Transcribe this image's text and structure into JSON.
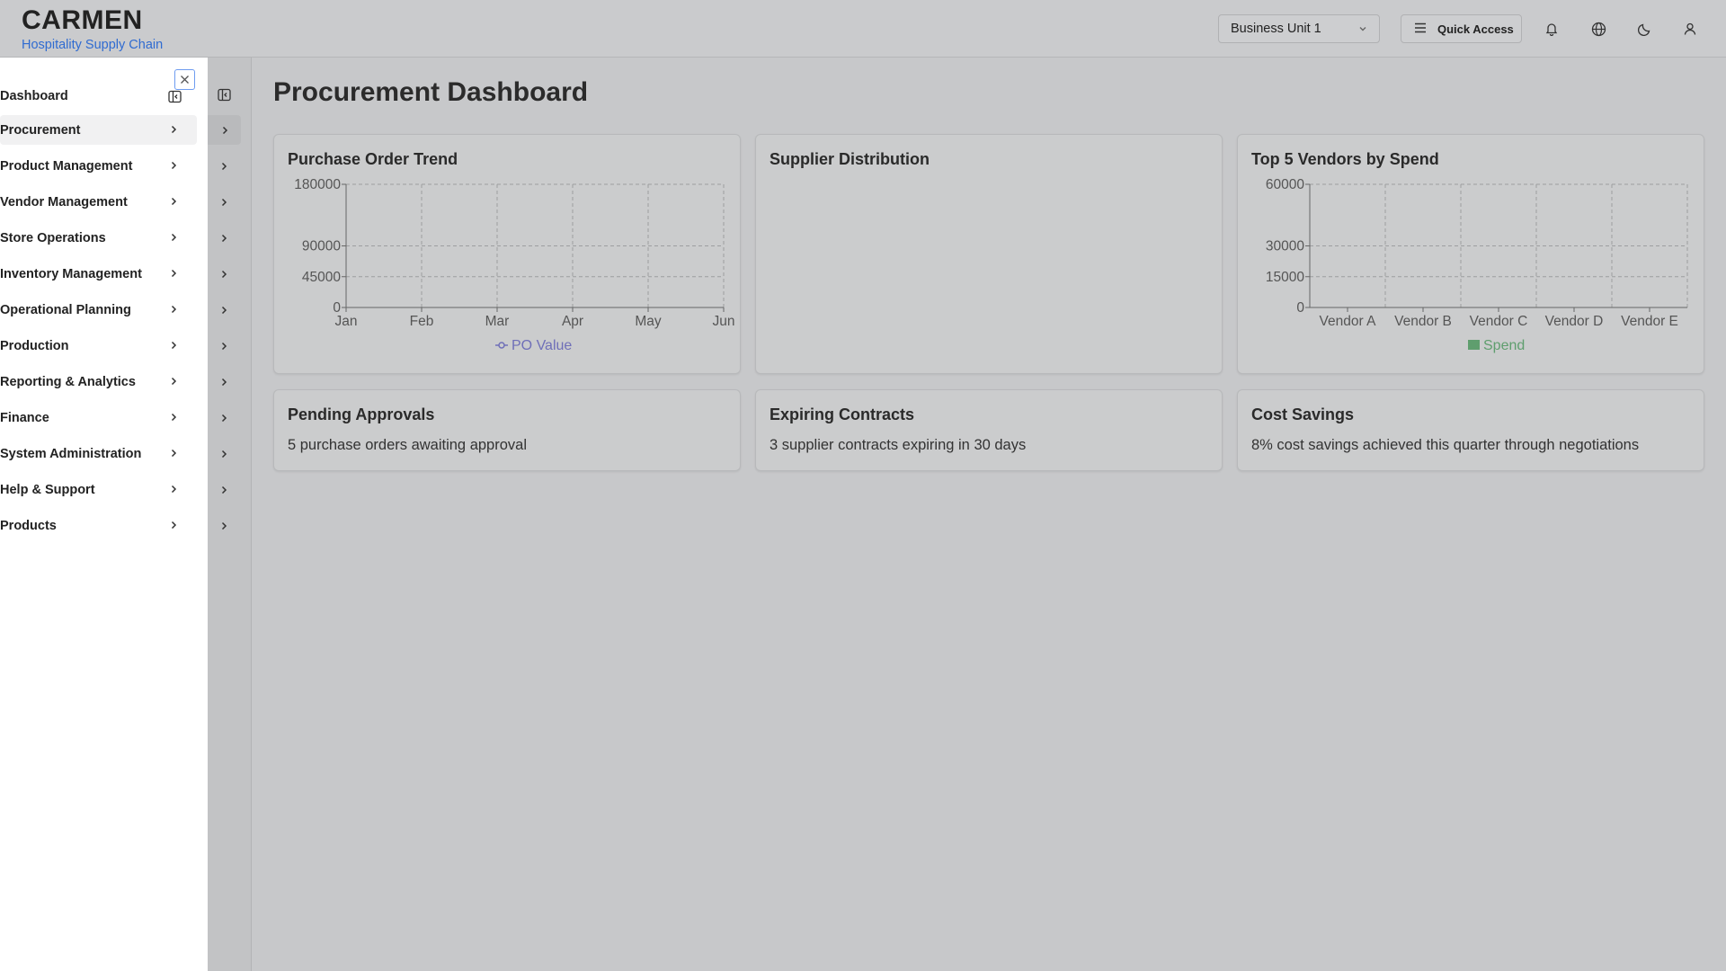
{
  "header": {
    "brand_title": "CARMEN",
    "brand_subtitle": "Hospitality Supply Chain",
    "business_unit": "Business Unit 1",
    "quick_access_label": "Quick Access",
    "icons": [
      "bell-icon",
      "globe-icon",
      "moon-icon",
      "user-icon"
    ]
  },
  "sidebar": {
    "dashboard_label": "Dashboard",
    "items": [
      {
        "label": "Procurement",
        "active": true
      },
      {
        "label": "Product Management"
      },
      {
        "label": "Vendor Management"
      },
      {
        "label": "Store Operations"
      },
      {
        "label": "Inventory Management"
      },
      {
        "label": "Operational Planning"
      },
      {
        "label": "Production"
      },
      {
        "label": "Reporting & Analytics"
      },
      {
        "label": "Finance"
      },
      {
        "label": "System Administration"
      },
      {
        "label": "Help & Support"
      },
      {
        "label": "Products"
      }
    ]
  },
  "main": {
    "title": "Procurement Dashboard",
    "cards": {
      "po_trend_title": "Purchase Order Trend",
      "supplier_title": "Supplier Distribution",
      "vendors_title": "Top 5 Vendors by Spend",
      "pending_title": "Pending Approvals",
      "pending_text": "5 purchase orders awaiting approval",
      "contracts_title": "Expiring Contracts",
      "contracts_text": "3 supplier contracts expiring in 30 days",
      "savings_title": "Cost Savings",
      "savings_text": "8% cost savings achieved this quarter through negotiations"
    }
  },
  "colors": {
    "accent_blue": "#2f6bd1",
    "line_series": "#6f6fb8",
    "bar_series": "#5f9e6e"
  },
  "chart_data": [
    {
      "type": "line",
      "title": "Purchase Order Trend",
      "x": [
        "Jan",
        "Feb",
        "Mar",
        "Apr",
        "May",
        "Jun"
      ],
      "series": [
        {
          "name": "PO Value",
          "values": []
        }
      ],
      "yticks": [
        0,
        45000,
        90000,
        180000
      ],
      "ylim": [
        0,
        180000
      ],
      "grid": true,
      "legend": "bottom"
    },
    {
      "type": "bar",
      "title": "Top 5 Vendors by Spend",
      "categories": [
        "Vendor A",
        "Vendor B",
        "Vendor C",
        "Vendor D",
        "Vendor E"
      ],
      "series": [
        {
          "name": "Spend",
          "values": []
        }
      ],
      "yticks": [
        0,
        15000,
        30000,
        60000
      ],
      "ylim": [
        0,
        60000
      ],
      "grid": true,
      "legend": "bottom"
    }
  ]
}
